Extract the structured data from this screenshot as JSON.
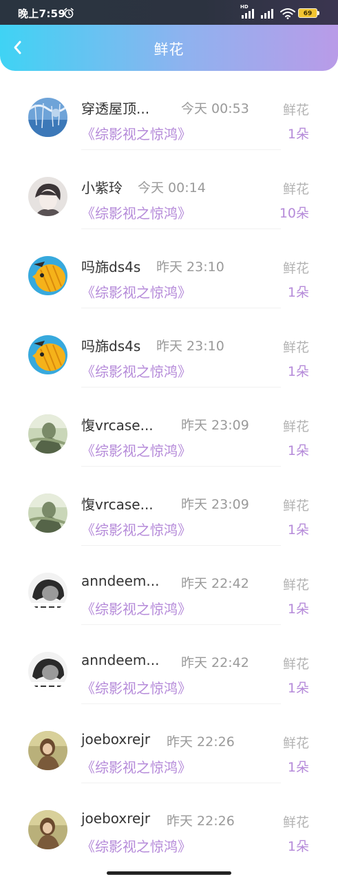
{
  "status_bar": {
    "time": "晚上7:59",
    "hd_label": "HD",
    "battery": "69"
  },
  "header": {
    "title": "鲜花"
  },
  "records": [
    {
      "username": "穿透屋顶...",
      "time": "今天 00:53",
      "book": "《综影视之惊鸿》",
      "gift": "鲜花",
      "count": "1朵"
    },
    {
      "username": "小紫玲",
      "time": "今天 00:14",
      "book": "《综影视之惊鸿》",
      "gift": "鲜花",
      "count": "10朵"
    },
    {
      "username": "吗旆ds4s",
      "time": "昨天 23:10",
      "book": "《综影视之惊鸿》",
      "gift": "鲜花",
      "count": "1朵"
    },
    {
      "username": "吗旆ds4s",
      "time": "昨天 23:10",
      "book": "《综影视之惊鸿》",
      "gift": "鲜花",
      "count": "1朵"
    },
    {
      "username": "愎vrcase...",
      "time": "昨天 23:09",
      "book": "《综影视之惊鸿》",
      "gift": "鲜花",
      "count": "1朵"
    },
    {
      "username": "愎vrcase...",
      "time": "昨天 23:09",
      "book": "《综影视之惊鸿》",
      "gift": "鲜花",
      "count": "1朵"
    },
    {
      "username": "anndeem...",
      "time": "昨天 22:42",
      "book": "《综影视之惊鸿》",
      "gift": "鲜花",
      "count": "1朵"
    },
    {
      "username": "anndeem...",
      "time": "昨天 22:42",
      "book": "《综影视之惊鸿》",
      "gift": "鲜花",
      "count": "1朵"
    },
    {
      "username": "joeboxrejr",
      "time": "昨天 22:26",
      "book": "《综影视之惊鸿》",
      "gift": "鲜花",
      "count": "1朵"
    },
    {
      "username": "joeboxrejr",
      "time": "昨天 22:26",
      "book": "《综影视之惊鸿》",
      "gift": "鲜花",
      "count": "1朵"
    }
  ],
  "colors": {
    "accent_purple": "#b58ad9",
    "header_start": "#3fd3f4",
    "header_end": "#b99be8"
  },
  "icons": {
    "back": "chevron-left-icon",
    "alarm": "alarm-clock-icon",
    "signal": "cellular-signal-icon",
    "wifi": "wifi-icon",
    "battery": "battery-icon"
  }
}
